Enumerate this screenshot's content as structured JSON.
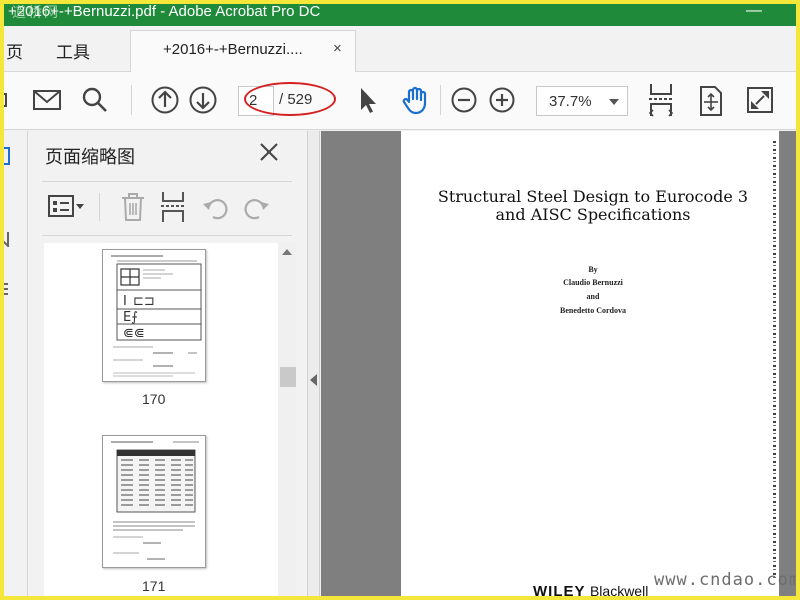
{
  "window": {
    "title": "+2016+-+Bernuzzi.pdf - Adobe Acrobat Pro DC",
    "watermark_logo": "道桥网",
    "minimize_glyph": "—"
  },
  "menu": {
    "items": [
      "页",
      "工具"
    ]
  },
  "tab": {
    "label": "+2016+-+Bernuzzi....",
    "close": "×"
  },
  "toolbar": {
    "page_current": "2",
    "page_total": "/ 529",
    "zoom": "37.7%",
    "icons": [
      "print-icon",
      "mail-icon",
      "search-icon",
      "prev-page-icon",
      "next-page-icon",
      "select-cursor-icon",
      "hand-tool-icon",
      "zoom-out-icon",
      "zoom-in-icon",
      "fit-width-icon",
      "fit-page-icon",
      "fullscreen-icon"
    ],
    "accent_color": "#1a6fd0",
    "highlight_color": "#d42020"
  },
  "thumbnails": {
    "title": "页面缩略图",
    "items": [
      {
        "page": "170"
      },
      {
        "page": "171"
      }
    ]
  },
  "document": {
    "title_line1": "Structural Steel Design to Eurocode 3",
    "title_line2": "and AISC Specifications",
    "by": "By",
    "author1": "Claudio Bernuzzi",
    "and": "and",
    "author2": "Benedetto Cordova",
    "publisher_a": "WILEY",
    "publisher_b": "Blackwell"
  },
  "footer": {
    "site": "www.cndao.com"
  }
}
